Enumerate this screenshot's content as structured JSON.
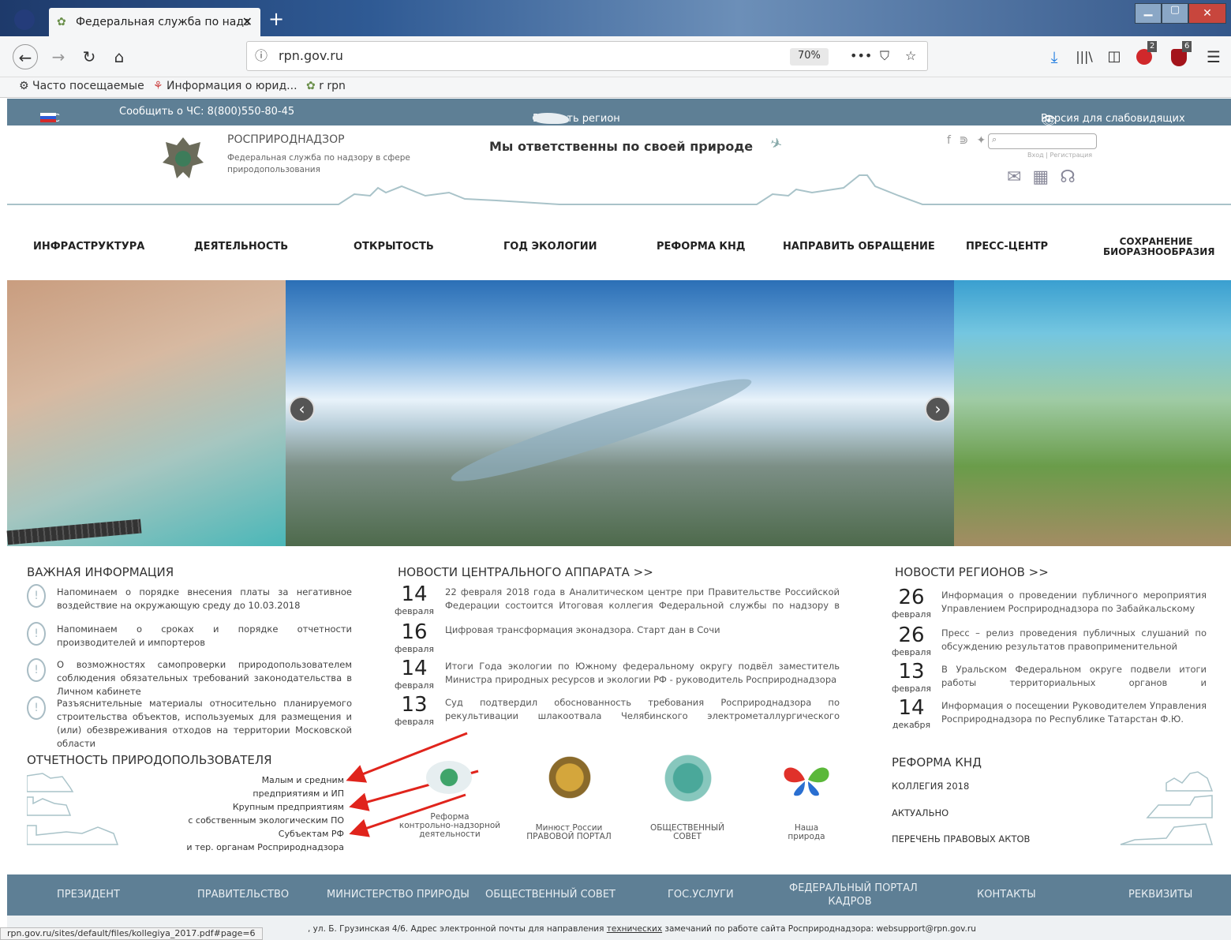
{
  "browser": {
    "tab_title": "Федеральная служба по надз",
    "url": "rpn.gov.ru",
    "zoom": "70%",
    "bookmarks": [
      "Часто посещаемые",
      "Информация о юрид...",
      "r rpn"
    ],
    "badges": [
      "2",
      "6"
    ]
  },
  "sitebar": {
    "lang": "РУС",
    "hotline": "Сообщить о ЧС: 8(800)550-80-45",
    "region": "Выбрать регион",
    "accessibility": "Версия для слабовидящих"
  },
  "header": {
    "org_short": "РОСПРИРОДНАДЗОР",
    "org_full": "Федеральная служба по надзору в сфере природопользования",
    "slogan": "Мы ответственны по своей природе",
    "login": "Вход",
    "register": "Регистрация"
  },
  "menu": [
    "ИНФРАСТРУКТУРА",
    "ДЕЯТЕЛЬНОСТЬ",
    "ОТКРЫТОСТЬ",
    "ГОД ЭКОЛОГИИ",
    "РЕФОРМА КНД",
    "НАПРАВИТЬ ОБРАЩЕНИЕ",
    "ПРЕСС-ЦЕНТР",
    "СОХРАНЕНИЕ БИОРАЗНООБРАЗИЯ"
  ],
  "important": {
    "title": "ВАЖНАЯ ИНФОРМАЦИЯ",
    "items": [
      "Напоминаем о порядке внесения платы за негативное воздействие на окружающую среду до 10.03.2018",
      "Напоминаем о сроках и порядке отчетности производителей и импортеров",
      "О возможностях самопроверки природопользователем соблюдения обязательных требований законодательства в Личном кабинете",
      "Разъяснительные материалы относительно планируемого строительства объектов, используемых для размещения и (или) обезвреживания отходов на территории Московской области"
    ]
  },
  "central_news": {
    "title": "НОВОСТИ ЦЕНТРАЛЬНОГО АППАРАТА >>",
    "items": [
      {
        "day": "14",
        "month": "февраля",
        "text": "22 февраля 2018 года в Аналитическом центре при Правительстве Российской Федерации состоится Итоговая коллегия Федеральной службы по надзору в сфере"
      },
      {
        "day": "16",
        "month": "февраля",
        "text": "Цифровая трансформация эконадзора. Старт дан в Сочи"
      },
      {
        "day": "14",
        "month": "февраля",
        "text": "Итоги Года экологии по Южному федеральному округу подвёл заместитель Министра природных ресурсов и экологии РФ - руководитель Росприроднадзора"
      },
      {
        "day": "13",
        "month": "февраля",
        "text": "Суд подтвердил обоснованность требования Росприроднадзора по рекультивации шлакоотвала Челябинского электрометаллургического комбината"
      }
    ]
  },
  "regional_news": {
    "title": "НОВОСТИ РЕГИОНОВ >>",
    "items": [
      {
        "day": "26",
        "month": "февраля",
        "text": "Информация о проведении публичного мероприятия Управлением Росприроднадзора по Забайкальскому"
      },
      {
        "day": "26",
        "month": "февраля",
        "text": "Пресс – релиз проведения публичных слушаний по обсуждению результатов правоприменительной"
      },
      {
        "day": "13",
        "month": "февраля",
        "text": "В Уральском Федеральном округе подвели итоги работы территориальных органов и подведомственных"
      },
      {
        "day": "14",
        "month": "декабря",
        "text": "Информация о посещении Руководителем Управления Росприроднадзора по Республике Татарстан Ф.Ю."
      }
    ]
  },
  "reporting": {
    "title": "ОТЧЕТНОСТЬ ПРИРОДОПОЛЬЗОВАТЕЛЯ",
    "lines": [
      "Малым и средним",
      "предприятиям и ИП",
      "Крупным предприятиям",
      "с собственным экологическим ПО",
      "Субъектам РФ",
      "и тер. органам Росприроднадзора"
    ]
  },
  "partners": [
    {
      "label1": "Реформа",
      "label2": "контрольно-надзорной",
      "label3": "деятельности"
    },
    {
      "label1": "Минюст России",
      "label2": "ПРАВОВОЙ ПОРТАЛ"
    },
    {
      "label1": "ОБЩЕСТВЕННЫЙ",
      "label2": "СОВЕТ"
    },
    {
      "label1": "Наша",
      "label2": "природа"
    }
  ],
  "knd": {
    "title": "РЕФОРМА КНД",
    "links": [
      "КОЛЛЕГИЯ 2018",
      "АКТУАЛЬНО",
      "ПЕРЕЧЕНЬ ПРАВОВЫХ АКТОВ"
    ]
  },
  "footer": {
    "links": [
      "ПРЕЗИДЕНТ",
      "ПРАВИТЕЛЬСТВО",
      "МИНИСТЕРСТВО ПРИРОДЫ",
      "ОБЩЕСТВЕННЫЙ СОВЕТ",
      "ГОС.УСЛУГИ",
      "ФЕДЕРАЛЬНЫЙ ПОРТАЛ",
      "КАДРОВ",
      "КОНТАКТЫ",
      "РЕКВИЗИТЫ"
    ],
    "address_pre": ", ул. Б. Грузинская 4/6. Адрес электронной почты для направления ",
    "address_link": "технических",
    "address_post": " замечаний по работе сайта Росприроднадзора: websupport@rpn.gov.ru",
    "status_url": "rpn.gov.ru/sites/default/files/kollegiya_2017.pdf#page=6"
  },
  "colors": {
    "bar": "#5e7f95",
    "accent_arrow": "#e0241c",
    "line": "#a9c3c9"
  }
}
